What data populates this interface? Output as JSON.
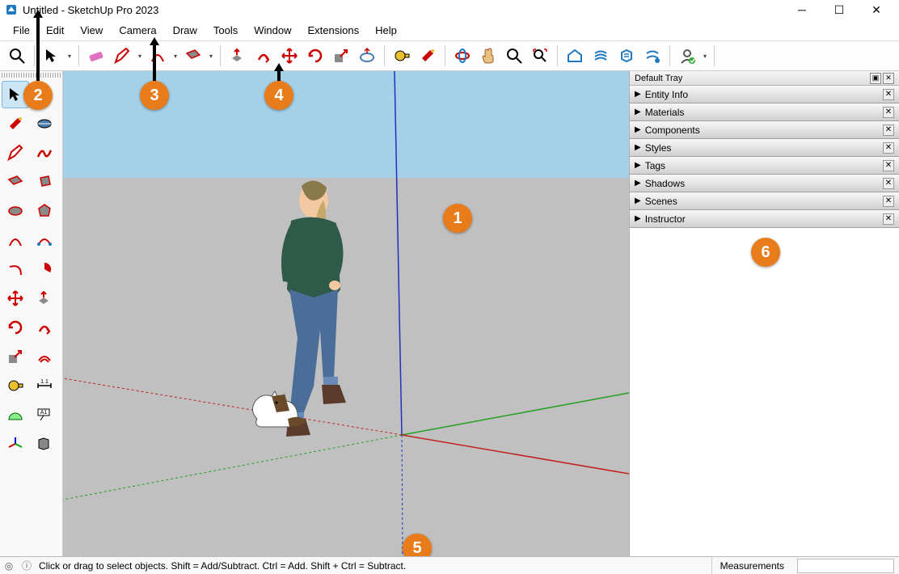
{
  "title": "Untitled - SketchUp Pro 2023",
  "menu": [
    "File",
    "Edit",
    "View",
    "Camera",
    "Draw",
    "Tools",
    "Window",
    "Extensions",
    "Help"
  ],
  "toolbar_icons": [
    "zoom",
    "select",
    "sel-drop",
    "|",
    "eraser",
    "pencil",
    "pencil-drop",
    "arc",
    "arc-drop",
    "rect",
    "rect-drop",
    "|",
    "pushpull",
    "followme",
    "move",
    "rotate",
    "scale",
    "offset",
    "|",
    "tape",
    "paint",
    "|",
    "orbit",
    "pan",
    "zoom2",
    "zoom-ext",
    "|",
    "warehouse",
    "ext-mgr",
    "ext-whs",
    "share",
    "|",
    "signin"
  ],
  "large_toolset": [
    "select",
    "make-component",
    "paint",
    "eraser",
    "line",
    "freehand",
    "rectangle",
    "rotated-rect",
    "circle",
    "polygon",
    "arc",
    "2pt-arc",
    "3pt-arc",
    "pie",
    "move",
    "pushpull",
    "rotate",
    "followme",
    "scale",
    "offset",
    "tape",
    "dimension",
    "protractor",
    "text",
    "axes",
    "3d-text"
  ],
  "tray": {
    "title": "Default Tray",
    "panels": [
      "Entity Info",
      "Materials",
      "Components",
      "Styles",
      "Tags",
      "Shadows",
      "Scenes",
      "Instructor"
    ]
  },
  "status": {
    "hint": "Click or drag to select objects. Shift = Add/Subtract. Ctrl = Add. Shift + Ctrl = Subtract.",
    "measurements_label": "Measurements"
  },
  "callouts": {
    "c1": "1",
    "c2": "2",
    "c3": "3",
    "c4": "4",
    "c5": "5",
    "c6": "6"
  }
}
